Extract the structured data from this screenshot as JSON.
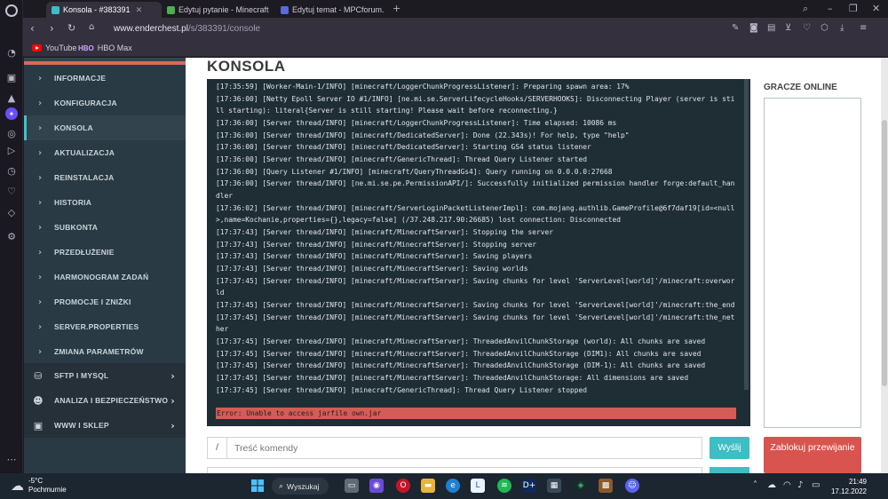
{
  "browser": {
    "tabs": [
      {
        "title": "Konsola - #383391",
        "color": "#3dbdc4"
      },
      {
        "title": "Edytuj pytanie - Minecraft",
        "color": "#4caf50"
      },
      {
        "title": "Edytuj temat - MPCforum.",
        "color": "#5b6bd8"
      }
    ],
    "new_tab_icon": "plus-icon",
    "url_host": "www.enderchest.pl",
    "url_path": "/s/383391/console",
    "bookmarks": [
      {
        "label": "YouTube",
        "icon": "youtube-icon"
      },
      {
        "label": "HBO Max",
        "icon": "hbo-icon",
        "mark": "HBO"
      }
    ]
  },
  "sidebar": {
    "items": [
      {
        "label": "INFORMACJE"
      },
      {
        "label": "KONFIGURACJA"
      },
      {
        "label": "KONSOLA",
        "active": true
      },
      {
        "label": "AKTUALIZACJA"
      },
      {
        "label": "REINSTALACJA"
      },
      {
        "label": "HISTORIA"
      },
      {
        "label": "SUBKONTA"
      },
      {
        "label": "PRZEDŁUŻENIE"
      },
      {
        "label": "HARMONOGRAM ZADAŃ"
      },
      {
        "label": "PROMOCJE I ZNIŻKI"
      },
      {
        "label": "SERVER.PROPERTIES"
      },
      {
        "label": "ZMIANA PARAMETRÓW"
      }
    ],
    "groups": [
      {
        "label": "SFTP I MYSQL",
        "icon": "database-icon"
      },
      {
        "label": "ANALIZA I BEZPIECZEŃSTWO",
        "icon": "user-shield-icon"
      },
      {
        "label": "WWW I SKLEP",
        "icon": "window-icon"
      }
    ]
  },
  "page": {
    "title": "KONSOLA",
    "players_title": "GRACZE ONLINE",
    "command_prefix": "/",
    "command_placeholder": "Treść komendy",
    "send_label": "Wyślij",
    "block_label": "Zablokuj przewijanie"
  },
  "console": {
    "lines": [
      "[17:35:59] [Worker-Main-1/INFO] [minecraft/LoggerChunkProgressListener]: Preparing spawn area: 17%",
      "[17:36:00] [Netty Epoll Server IO #1/INFO] [ne.mi.se.ServerLifecycleHooks/SERVERHOOKS]: Disconnecting Player (server is still starting): literal{Server is still starting! Please wait before reconnecting.}",
      "[17:36:00] [Server thread/INFO] [minecraft/LoggerChunkProgressListener]: Time elapsed: 10086 ms",
      "[17:36:00] [Server thread/INFO] [minecraft/DedicatedServer]: Done (22.343s)! For help, type \"help\"",
      "[17:36:00] [Server thread/INFO] [minecraft/DedicatedServer]: Starting GS4 status listener",
      "[17:36:00] [Server thread/INFO] [minecraft/GenericThread]: Thread Query Listener started",
      "[17:36:00] [Query Listener #1/INFO] [minecraft/QueryThreadGs4]: Query running on 0.0.0.0:27668",
      "[17:36:00] [Server thread/INFO] [ne.mi.se.pe.PermissionAPI/]: Successfully initialized permission handler forge:default_handler",
      "[17:36:02] [Server thread/INFO] [minecraft/ServerLoginPacketListenerImpl]: com.mojang.authlib.GameProfile@6f7daf19[id=<null>,name=Kochanie,properties={},legacy=false] (/37.248.217.90:26685) lost connection: Disconnected",
      "[17:37:43] [Server thread/INFO] [minecraft/MinecraftServer]: Stopping the server",
      "[17:37:43] [Server thread/INFO] [minecraft/MinecraftServer]: Stopping server",
      "[17:37:43] [Server thread/INFO] [minecraft/MinecraftServer]: Saving players",
      "[17:37:43] [Server thread/INFO] [minecraft/MinecraftServer]: Saving worlds",
      "[17:37:45] [Server thread/INFO] [minecraft/MinecraftServer]: Saving chunks for level 'ServerLevel[world]'/minecraft:overworld",
      "[17:37:45] [Server thread/INFO] [minecraft/MinecraftServer]: Saving chunks for level 'ServerLevel[world]'/minecraft:the_end",
      "[17:37:45] [Server thread/INFO] [minecraft/MinecraftServer]: Saving chunks for level 'ServerLevel[world]'/minecraft:the_nether",
      "[17:37:45] [Server thread/INFO] [minecraft/MinecraftServer]: ThreadedAnvilChunkStorage (world): All chunks are saved",
      "[17:37:45] [Server thread/INFO] [minecraft/MinecraftServer]: ThreadedAnvilChunkStorage (DIM1): All chunks are saved",
      "[17:37:45] [Server thread/INFO] [minecraft/MinecraftServer]: ThreadedAnvilChunkStorage (DIM-1): All chunks are saved",
      "[17:37:45] [Server thread/INFO] [minecraft/MinecraftServer]: ThreadedAnvilChunkStorage: All dimensions are saved",
      "[17:37:45] [Server thread/INFO] [minecraft/GenericThread]: Thread Query Listener stopped"
    ],
    "error": "Error: Unable to access jarfile own.jar"
  },
  "taskbar": {
    "temperature": "-5°C",
    "weather": "Pochmurnie",
    "search_label": "Wyszukaj",
    "time": "21:49",
    "date": "17.12.2022"
  }
}
